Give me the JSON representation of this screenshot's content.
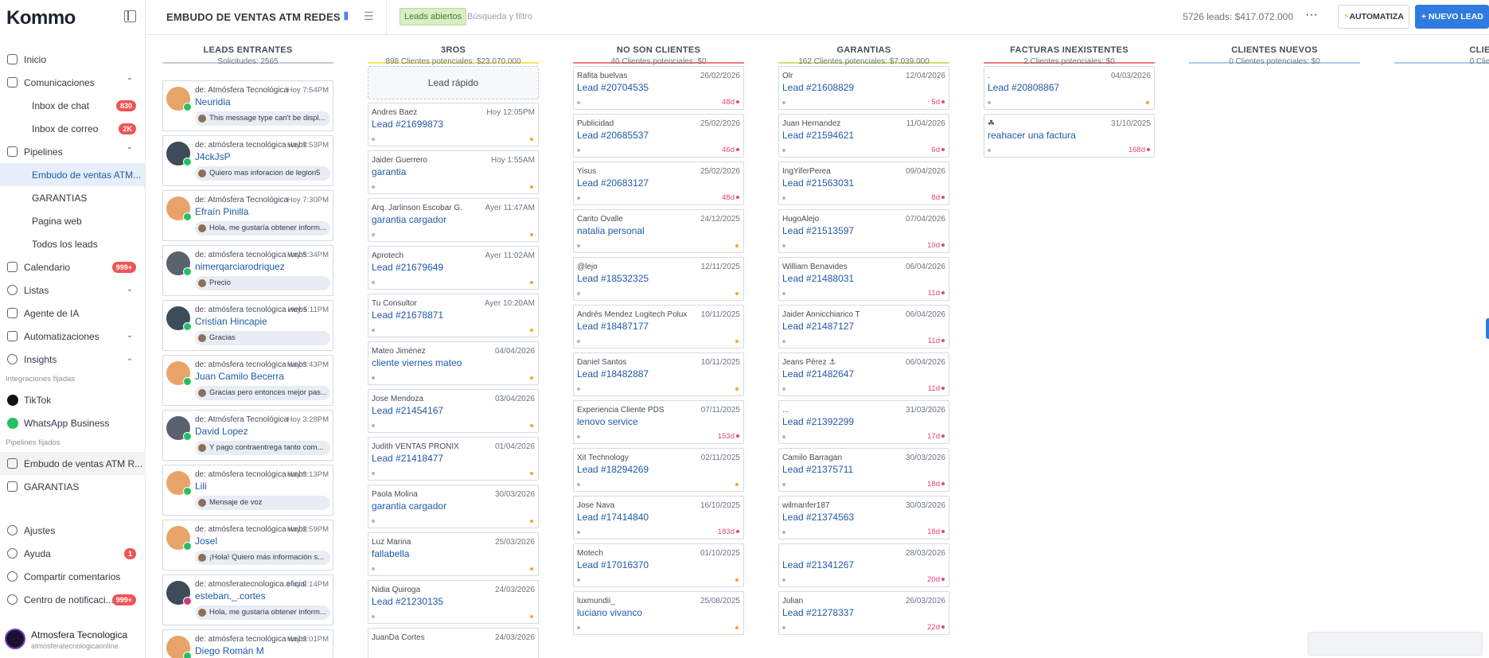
{
  "sidebar": {
    "logo": "Kommo",
    "nav": [
      {
        "label": "Inicio"
      },
      {
        "label": "Comunicaciones",
        "chevron": "^"
      },
      {
        "label": "Inbox de chat",
        "badge": "830"
      },
      {
        "label": "Inbox de correo",
        "badge": "2K"
      },
      {
        "label": "Pipelines",
        "chevron": "^"
      },
      {
        "label": "Embudo de ventas ATM..."
      },
      {
        "label": "GARANTIAS"
      },
      {
        "label": "Pagina web"
      },
      {
        "label": "Todos los leads"
      },
      {
        "label": "Calendario",
        "badge": "999+"
      },
      {
        "label": "Listas",
        "chevron": "v"
      },
      {
        "label": "Agente de IA"
      },
      {
        "label": "Automatizaciones",
        "chevron": "v"
      },
      {
        "label": "Insights",
        "chevron": "v"
      }
    ],
    "pinned_integrations_label": "Integraciones fijadas",
    "integrations": [
      {
        "label": "TikTok",
        "color": "#111111"
      },
      {
        "label": "WhatsApp Business",
        "color": "#25c063"
      }
    ],
    "pinned_pipelines_label": "Pipelines fijados",
    "pinned_pipelines": [
      {
        "label": "Embudo de ventas ATM R..."
      },
      {
        "label": "GARANTIAS"
      }
    ],
    "bottom": [
      {
        "label": "Ajustes"
      },
      {
        "label": "Ayuda",
        "badge": "1"
      },
      {
        "label": "Compartir comentarios"
      },
      {
        "label": "Centro de notificaci...",
        "badge": "999+"
      }
    ],
    "user": {
      "name": "Atmosfera Tecnologica",
      "email": "atmosferatecnologicaonline"
    }
  },
  "topbar": {
    "title": "EMBUDO DE VENTAS ATM REDES",
    "filter_tag": "Leads abiertos",
    "search_placeholder": "Búsqueda y filtro",
    "summary": "5726 leads: $417.072.000",
    "more": "···",
    "automate": "AUTOMATIZA",
    "new_lead": "+ NUEVO LEAD"
  },
  "colors": {
    "accent": "#2f7be0",
    "link": "#1f5aa8",
    "badge": "#f05454"
  },
  "columns": [
    {
      "title": "LEADS ENTRANTES",
      "sub": "Solicitudes: 2565",
      "color": "#c6ccd2"
    },
    {
      "title": "3ROS",
      "sub": "898 Clientes potenciales: $23.070.000",
      "color": "#f5e35a"
    },
    {
      "title": "NO SON CLIENTES",
      "sub": "40 Clientes potenciales: $0",
      "color": "#f07c7c"
    },
    {
      "title": "GARANTIAS",
      "sub": "162 Clientes potenciales: $7.039.000",
      "color": "#c6e66a"
    },
    {
      "title": "FACTURAS INEXISTENTES",
      "sub": "2 Clientes potenciales: $0",
      "color": "#f07c7c"
    },
    {
      "title": "CLIENTES NUEVOS",
      "sub": "0 Clientes potenciales: $0",
      "color": "#a9cdf2"
    },
    {
      "title": "CLIE",
      "sub": "0 Clie",
      "color": "#a9cdf2"
    }
  ],
  "incoming": [
    {
      "from": "de: Atmósfera Tecnológica",
      "time": "Hoy 7:54PM",
      "name": "Neuridia",
      "msg": "This message type can't be displ...",
      "av": "a1",
      "src": "wa"
    },
    {
      "from": "de: atmósfera tecnológica webs",
      "time": "Hoy 7:53PM",
      "name": "J4ckJsP",
      "msg": "Quiero mas inforacion de legion5",
      "av": "a2",
      "src": "wa"
    },
    {
      "from": "de: Atmósfera Tecnológica",
      "time": "Hoy 7:30PM",
      "name": "Efraín Pinilla",
      "msg": "Hola, me gustaría obtener inform...",
      "av": "a1",
      "src": "wa"
    },
    {
      "from": "de: atmósfera tecnológica webs",
      "time": "Hoy 5:34PM",
      "name": "nimerqarciarodriquez",
      "msg": "Precio",
      "av": "a3",
      "src": "wa"
    },
    {
      "from": "de: atmósfera tecnológica webs",
      "time": "Hoy 5:11PM",
      "name": "Cristian Hincapie",
      "msg": "Gracias",
      "av": "a2",
      "src": "wa"
    },
    {
      "from": "de: atmósfera tecnológica webs",
      "time": "Hoy 3:43PM",
      "name": "Juan Camilo Becerra",
      "msg": "Gracias pero entonces mejor pas...",
      "av": "a1",
      "src": "wa"
    },
    {
      "from": "de: Atmósfera Tecnológica",
      "time": "Hoy 3:28PM",
      "name": "David Lopez",
      "msg": "Y pago contraentrega tanto com...",
      "av": "a3",
      "src": "wa"
    },
    {
      "from": "de: atmósfera tecnológica webs",
      "time": "Hoy 3:13PM",
      "name": "Lili",
      "msg": "Mensaje de voz",
      "av": "a1",
      "src": "wa"
    },
    {
      "from": "de: atmósfera tecnológica webs",
      "time": "Hoy 2:59PM",
      "name": "Josel",
      "msg": "¡Hola! Quiero más información s...",
      "av": "a1",
      "src": "wa"
    },
    {
      "from": "de: atmosferatecnologica.oficial",
      "time": "Hoy 2:14PM",
      "name": "esteban._.cortes",
      "msg": "Hola, me gustaría obtener inform...",
      "av": "a2",
      "src": "ig"
    },
    {
      "from": "de: atmósfera tecnológica webs",
      "time": "Hoy 2:01PM",
      "name": "Diego Román M",
      "msg": "",
      "av": "a1",
      "src": "wa"
    }
  ],
  "quick_add": "Lead rápido",
  "terceros": [
    {
      "who": "Andres Baez",
      "date": "Hoy 12:05PM",
      "lead": "Lead #21699873"
    },
    {
      "who": "Jaider Guerrero",
      "date": "Hoy 1:55AM",
      "lead": "garantia"
    },
    {
      "who": "Arq. Jarlinson Escobar G.",
      "date": "Ayer 11:47AM",
      "lead": "garantia cargador"
    },
    {
      "who": "Aprotech",
      "date": "Ayer 11:02AM",
      "lead": "Lead #21679649"
    },
    {
      "who": "Tu Consultor",
      "date": "Ayer 10:20AM",
      "lead": "Lead #21678871"
    },
    {
      "who": "Mateo Jiménez",
      "date": "04/04/2026",
      "lead": "cliente viernes mateo"
    },
    {
      "who": "Jose Mendoza",
      "date": "03/04/2026",
      "lead": "Lead #21454167"
    },
    {
      "who": "Judith VENTAS PRONÍX",
      "date": "01/04/2026",
      "lead": "Lead #21418477"
    },
    {
      "who": "Paola Molina",
      "date": "30/03/2026",
      "lead": "garantia cargador"
    },
    {
      "who": "Luz Marina",
      "date": "25/03/2026",
      "lead": "fallabella"
    },
    {
      "who": "Nidia Quiroga",
      "date": "24/03/2026",
      "lead": "Lead #21230135"
    },
    {
      "who": "JuanDa Cortes",
      "date": "24/03/2026",
      "lead": ""
    }
  ],
  "no_clientes": [
    {
      "who": "Rafita buelvas",
      "date": "26/02/2026",
      "lead": "Lead #20704535",
      "days": "48d"
    },
    {
      "who": "Publicidad",
      "date": "25/02/2026",
      "lead": "Lead #20685537",
      "days": "46d"
    },
    {
      "who": "Yisus",
      "date": "25/02/2026",
      "lead": "Lead #20683127",
      "days": "48d"
    },
    {
      "who": "Carito Ovalle",
      "date": "24/12/2025",
      "lead": "natalia personal",
      "days": ""
    },
    {
      "who": "@lejo",
      "date": "12/11/2025",
      "lead": "Lead #18532325",
      "days": ""
    },
    {
      "who": "Andrés Mendez Logitech Polux",
      "date": "10/11/2025",
      "lead": "Lead #18487177",
      "days": ""
    },
    {
      "who": "Daniel Santos",
      "date": "10/11/2025",
      "lead": "Lead #18482887",
      "days": ""
    },
    {
      "who": "Experiencia Cliente PDS",
      "date": "07/11/2025",
      "lead": "lenovo service",
      "days": "153d"
    },
    {
      "who": "Xit Technology",
      "date": "02/11/2025",
      "lead": "Lead #18294269",
      "days": ""
    },
    {
      "who": "Jose Nava",
      "date": "16/10/2025",
      "lead": "Lead #17414840",
      "days": "183d"
    },
    {
      "who": "Motech",
      "date": "01/10/2025",
      "lead": "Lead #17016370",
      "days": ""
    },
    {
      "who": "luxmundii_",
      "date": "25/08/2025",
      "lead": "luciano vivanco",
      "days": ""
    }
  ],
  "garantias": [
    {
      "who": "Olr",
      "date": "12/04/2026",
      "lead": "Lead #21608829",
      "days": "5d"
    },
    {
      "who": "Juan Hernandez",
      "date": "11/04/2026",
      "lead": "Lead #21594621",
      "days": "6d"
    },
    {
      "who": "IngYiferPerea",
      "date": "09/04/2026",
      "lead": "Lead #21563031",
      "days": "8d"
    },
    {
      "who": "HugoAlejo",
      "date": "07/04/2026",
      "lead": "Lead #21513597",
      "days": "10d"
    },
    {
      "who": "William Benavides",
      "date": "06/04/2026",
      "lead": "Lead #21488031",
      "days": "11d"
    },
    {
      "who": "Jaider Annicchiarico T",
      "date": "06/04/2026",
      "lead": "Lead #21487127",
      "days": "11d"
    },
    {
      "who": "Jeans Pérez ⚓",
      "date": "06/04/2026",
      "lead": "Lead #21482647",
      "days": "11d"
    },
    {
      "who": "...",
      "date": "31/03/2026",
      "lead": "Lead #21392299",
      "days": "17d"
    },
    {
      "who": "Camilo Barragan",
      "date": "30/03/2026",
      "lead": "Lead #21375711",
      "days": "18d"
    },
    {
      "who": "wilmanfer187",
      "date": "30/03/2026",
      "lead": "Lead #21374563",
      "days": "18d"
    },
    {
      "who": "",
      "date": "28/03/2026",
      "lead": "Lead #21341267",
      "days": "20d"
    },
    {
      "who": "Julian",
      "date": "26/03/2026",
      "lead": "Lead #21278337",
      "days": "22d"
    }
  ],
  "facturas": [
    {
      "who": ".",
      "date": "04/03/2026",
      "lead": "Lead #20808867",
      "days": ""
    },
    {
      "who": "☘",
      "date": "31/10/2025",
      "lead": "reahacer una factura",
      "days": "168d"
    }
  ]
}
